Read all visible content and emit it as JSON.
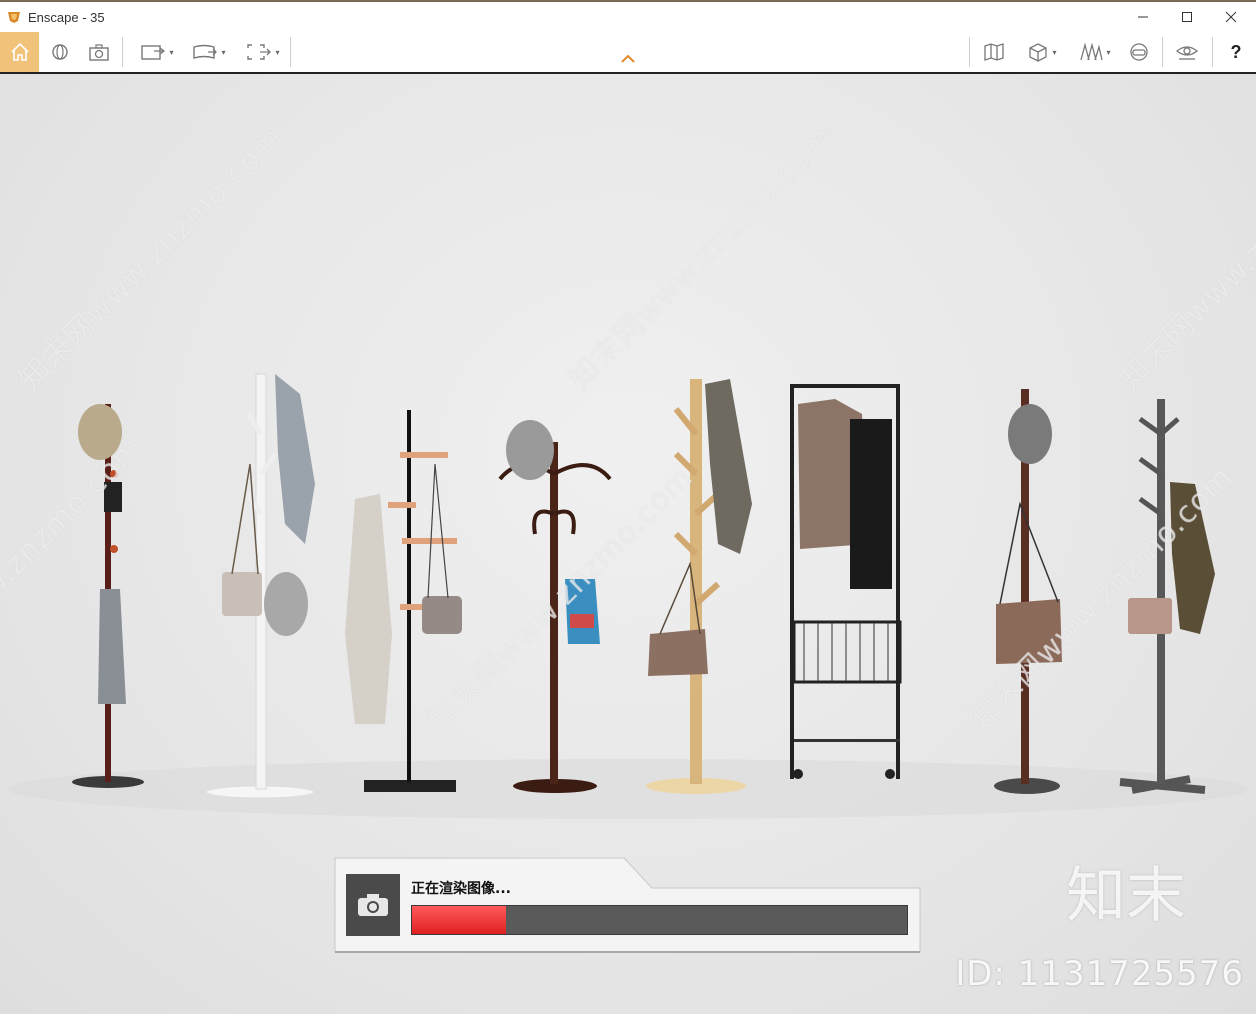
{
  "window": {
    "title": "Enscape - 35",
    "minimize_icon": "minimize-icon",
    "maximize_icon": "maximize-icon",
    "close_icon": "close-icon"
  },
  "toolbar": {
    "left_buttons": [
      "home-icon",
      "orbit-icon",
      "screenshot-icon",
      "video-editor-icon",
      "panorama-icon",
      "batch-render-icon"
    ],
    "right_buttons": [
      "map-icon",
      "asset-library-icon",
      "views-icon",
      "vr-headset-icon",
      "visual-settings-icon"
    ],
    "help_label": "?",
    "collapse_icon": "chevron-up-icon",
    "accent_color": "#f0c27a"
  },
  "scene": {
    "watermark_text": "知末网www.znzmo.com",
    "brand_mark": "知末",
    "id_label": "ID: 1131725576"
  },
  "render_dialog": {
    "label": "正在渲染图像...",
    "camera_icon": "camera-icon",
    "progress_fraction": 0.19,
    "progress_color": "#ff4040"
  }
}
